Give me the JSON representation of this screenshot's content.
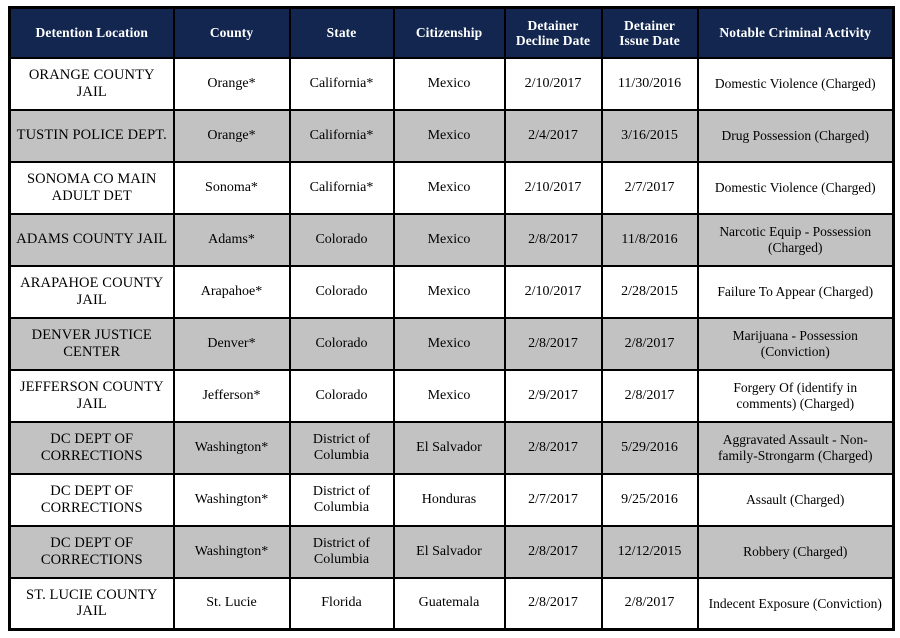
{
  "table": {
    "headers": [
      "Detention Location",
      "County",
      "State",
      "Citizenship",
      "Detainer Decline Date",
      "Detainer Issue Date",
      "Notable Criminal Activity"
    ],
    "header_lines": [
      [
        "Detention Location"
      ],
      [
        "County"
      ],
      [
        "State"
      ],
      [
        "Citizenship"
      ],
      [
        "Detainer",
        "Decline Date"
      ],
      [
        "Detainer",
        "Issue Date"
      ],
      [
        "Notable Criminal Activity"
      ]
    ],
    "colors": {
      "header_background": "#12264f",
      "header_text": "#ffffff",
      "row_shaded_background": "#c2c2c2",
      "row_plain_background": "#ffffff",
      "border": "#000000",
      "body_text": "#000000"
    },
    "rows": [
      {
        "detention_location": "ORANGE COUNTY JAIL",
        "county": "Orange*",
        "state": "California*",
        "citizenship": "Mexico",
        "detainer_decline_date": "2/10/2017",
        "detainer_issue_date": "11/30/2016",
        "notable_criminal_activity": "Domestic Violence (Charged)",
        "shaded": false
      },
      {
        "detention_location": "TUSTIN POLICE DEPT.",
        "county": "Orange*",
        "state": "California*",
        "citizenship": "Mexico",
        "detainer_decline_date": "2/4/2017",
        "detainer_issue_date": "3/16/2015",
        "notable_criminal_activity": "Drug Possession (Charged)",
        "shaded": true
      },
      {
        "detention_location": "SONOMA CO MAIN ADULT DET",
        "county": "Sonoma*",
        "state": "California*",
        "citizenship": "Mexico",
        "detainer_decline_date": "2/10/2017",
        "detainer_issue_date": "2/7/2017",
        "notable_criminal_activity": "Domestic Violence (Charged)",
        "shaded": false
      },
      {
        "detention_location": "ADAMS COUNTY JAIL",
        "county": "Adams*",
        "state": "Colorado",
        "citizenship": "Mexico",
        "detainer_decline_date": "2/8/2017",
        "detainer_issue_date": "11/8/2016",
        "notable_criminal_activity": "Narcotic Equip - Possession (Charged)",
        "shaded": true
      },
      {
        "detention_location": "ARAPAHOE COUNTY JAIL",
        "county": "Arapahoe*",
        "state": "Colorado",
        "citizenship": "Mexico",
        "detainer_decline_date": "2/10/2017",
        "detainer_issue_date": "2/28/2015",
        "notable_criminal_activity": "Failure To Appear (Charged)",
        "shaded": false
      },
      {
        "detention_location": "DENVER JUSTICE CENTER",
        "county": "Denver*",
        "state": "Colorado",
        "citizenship": "Mexico",
        "detainer_decline_date": "2/8/2017",
        "detainer_issue_date": "2/8/2017",
        "notable_criminal_activity": "Marijuana - Possession (Conviction)",
        "shaded": true
      },
      {
        "detention_location": "JEFFERSON COUNTY JAIL",
        "county": "Jefferson*",
        "state": "Colorado",
        "citizenship": "Mexico",
        "detainer_decline_date": "2/9/2017",
        "detainer_issue_date": "2/8/2017",
        "notable_criminal_activity": "Forgery Of (identify in comments) (Charged)",
        "shaded": false
      },
      {
        "detention_location": "DC DEPT OF CORRECTIONS",
        "county": "Washington*",
        "state": "District of Columbia",
        "citizenship": "El Salvador",
        "detainer_decline_date": "2/8/2017",
        "detainer_issue_date": "5/29/2016",
        "notable_criminal_activity": "Aggravated Assault - Non-family-Strongarm (Charged)",
        "shaded": true
      },
      {
        "detention_location": "DC DEPT OF CORRECTIONS",
        "county": "Washington*",
        "state": "District of Columbia",
        "citizenship": "Honduras",
        "detainer_decline_date": "2/7/2017",
        "detainer_issue_date": "9/25/2016",
        "notable_criminal_activity": "Assault (Charged)",
        "shaded": false
      },
      {
        "detention_location": "DC DEPT OF CORRECTIONS",
        "county": "Washington*",
        "state": "District of Columbia",
        "citizenship": "El Salvador",
        "detainer_decline_date": "2/8/2017",
        "detainer_issue_date": "12/12/2015",
        "notable_criminal_activity": "Robbery (Charged)",
        "shaded": true
      },
      {
        "detention_location": "ST. LUCIE COUNTY JAIL",
        "county": "St. Lucie",
        "state": "Florida",
        "citizenship": "Guatemala",
        "detainer_decline_date": "2/8/2017",
        "detainer_issue_date": "2/8/2017",
        "notable_criminal_activity": "Indecent Exposure (Conviction)",
        "shaded": false
      }
    ]
  }
}
